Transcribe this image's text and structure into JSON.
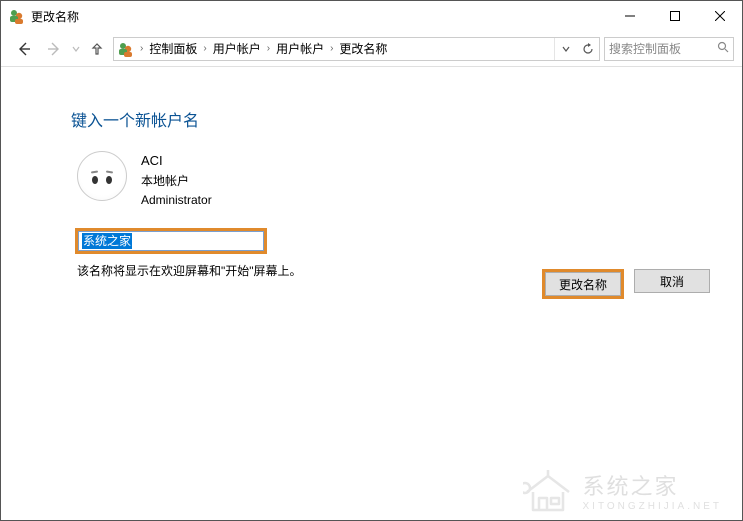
{
  "window": {
    "title": "更改名称"
  },
  "breadcrumbs": {
    "root_sep": "›",
    "items": [
      "控制面板",
      "用户帐户",
      "用户帐户",
      "更改名称"
    ]
  },
  "search": {
    "placeholder": "搜索控制面板"
  },
  "page": {
    "heading": "键入一个新帐户名",
    "account": {
      "name": "ACI",
      "type": "本地帐户",
      "role": "Administrator"
    },
    "input_value": "系统之家",
    "hint": "该名称将显示在欢迎屏幕和\"开始\"屏幕上。",
    "buttons": {
      "submit": "更改名称",
      "cancel": "取消"
    }
  },
  "watermark": {
    "text": "系统之家",
    "url": "XITONGZHIJIA.NET"
  }
}
